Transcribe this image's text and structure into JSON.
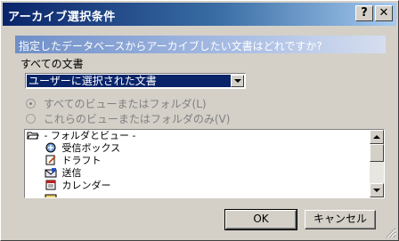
{
  "window": {
    "title": "アーカイブ選択条件"
  },
  "titlebar": {
    "help_glyph": "?",
    "close_glyph": "✕"
  },
  "prompt": "指定したデータベースからアーカイブしたい文書はどれですか?",
  "documents": {
    "label": "すべての文書",
    "selected": "ユーザーに選択された文書"
  },
  "radios": [
    {
      "label": "すべてのビューまたはフォルダ(L)",
      "checked": true,
      "enabled": false
    },
    {
      "label": "これらのビューまたはフォルダのみ(V)",
      "checked": false,
      "enabled": false
    }
  ],
  "tree": {
    "items": [
      {
        "label": "- フォルダとビュー -",
        "icon": "folder-open-icon"
      },
      {
        "label": "受信ボックス",
        "icon": "inbox-icon"
      },
      {
        "label": "ドラフト",
        "icon": "draft-icon"
      },
      {
        "label": "送信",
        "icon": "sent-icon"
      },
      {
        "label": "カレンダー",
        "icon": "calendar-icon"
      }
    ]
  },
  "buttons": {
    "ok": "OK",
    "cancel": "キャンセル"
  },
  "colors": {
    "titlebar_start": "#0a246a",
    "titlebar_end": "#a6caf0",
    "selection": "#0a246a",
    "face": "#d4d0c8"
  }
}
